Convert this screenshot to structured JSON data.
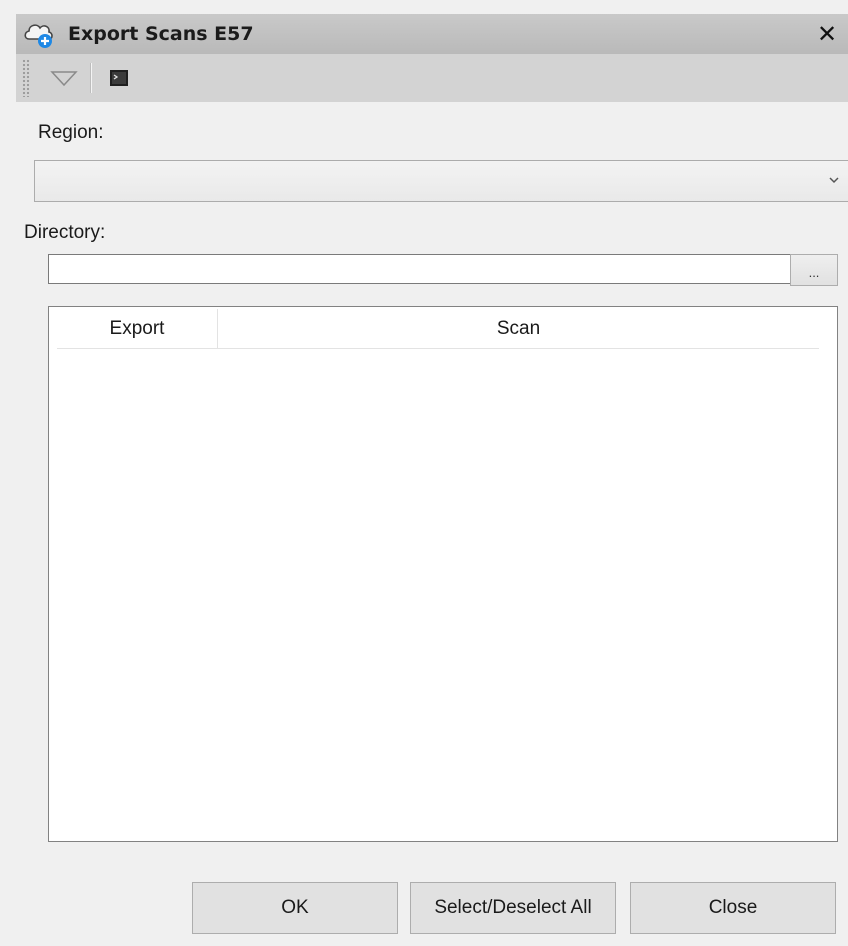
{
  "window": {
    "title": "Export Scans E57",
    "close_glyph": "✕"
  },
  "icons": {
    "title": "cloud-export-icon",
    "toolbar_dropdown": "triangle-down-icon",
    "toolbar_terminal": "terminal-icon",
    "combo_arrow": "chevron-down-icon"
  },
  "form": {
    "region_label": "Region:",
    "region_value": "",
    "directory_label": "Directory:",
    "directory_value": "",
    "browse_label": "..."
  },
  "table": {
    "columns": [
      "Export",
      "Scan"
    ],
    "rows": []
  },
  "buttons": {
    "ok": "OK",
    "select_all": "Select/Deselect All",
    "close": "Close"
  },
  "colors": {
    "titlebar": "#c2c2c2",
    "toolbar": "#d3d3d3",
    "accent_blue": "#1e88e5"
  }
}
